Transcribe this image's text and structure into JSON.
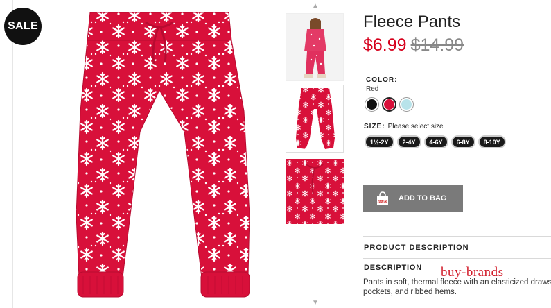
{
  "badge": {
    "sale": "SALE"
  },
  "product": {
    "title": "Fleece Pants",
    "price_sale": "$6.99",
    "price_original": "$14.99"
  },
  "color": {
    "label": "COLOR:",
    "selected": "Red",
    "swatches": [
      {
        "name": "Black",
        "hex": "#111111"
      },
      {
        "name": "Red",
        "hex": "#d8103a"
      },
      {
        "name": "Light Blue",
        "hex": "#b8e3ea"
      }
    ]
  },
  "size": {
    "label": "SIZE:",
    "hint": "Please select size",
    "options": [
      "1½-2Y",
      "2-4Y",
      "4-6Y",
      "6-8Y",
      "8-10Y"
    ]
  },
  "actions": {
    "add_to_bag": "ADD TO BAG",
    "bag_logo": "H&M"
  },
  "description": {
    "section_title": "PRODUCT DESCRIPTION",
    "subtitle": "DESCRIPTION",
    "line1": "Pants in soft, thermal fleece with an elasticized drawstring waistband, side",
    "line2": "pockets, and ribbed hems."
  },
  "watermark": "buy-brands",
  "colors": {
    "accent": "#d6001c",
    "pants_red": "#d8103a",
    "button_gray": "#7a7a7a"
  },
  "icons": {
    "thumb_up": "chevron-up-icon",
    "thumb_down": "chevron-down-icon",
    "bag": "shopping-bag-icon"
  }
}
